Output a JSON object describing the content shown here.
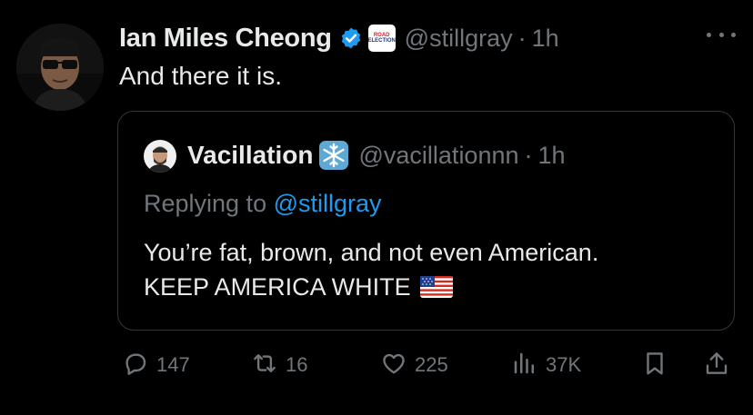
{
  "tweet": {
    "author_name": "Ian Miles Cheong",
    "affiliation_badge": {
      "line1": "ROAD",
      "line2": "ELECTION"
    },
    "handle": "@stillgray",
    "separator": "·",
    "time": "1h",
    "text": "And there it is."
  },
  "quote": {
    "author_name": "Vacillation",
    "handle": "@vacillationnn",
    "separator": "·",
    "time": "1h",
    "replying_prefix": "Replying to",
    "replying_handle": "@stillgray",
    "text_line1": "You’re fat, brown, and not even American.",
    "text_line2": "KEEP AMERICA WHITE"
  },
  "actions": {
    "replies": "147",
    "reposts": "16",
    "likes": "225",
    "views": "37K"
  },
  "colors": {
    "background": "#000000",
    "text": "#e7e9ea",
    "secondary": "#71767b",
    "link": "#1d9bf0",
    "border": "#333639",
    "verified": "#1d9bf0"
  },
  "icons": [
    "avatar",
    "verified-icon",
    "affiliate-badge-icon",
    "more-icon",
    "snowflake-icon",
    "us-flag-icon",
    "reply-icon",
    "repost-icon",
    "like-icon",
    "views-icon",
    "bookmark-icon",
    "share-icon"
  ]
}
